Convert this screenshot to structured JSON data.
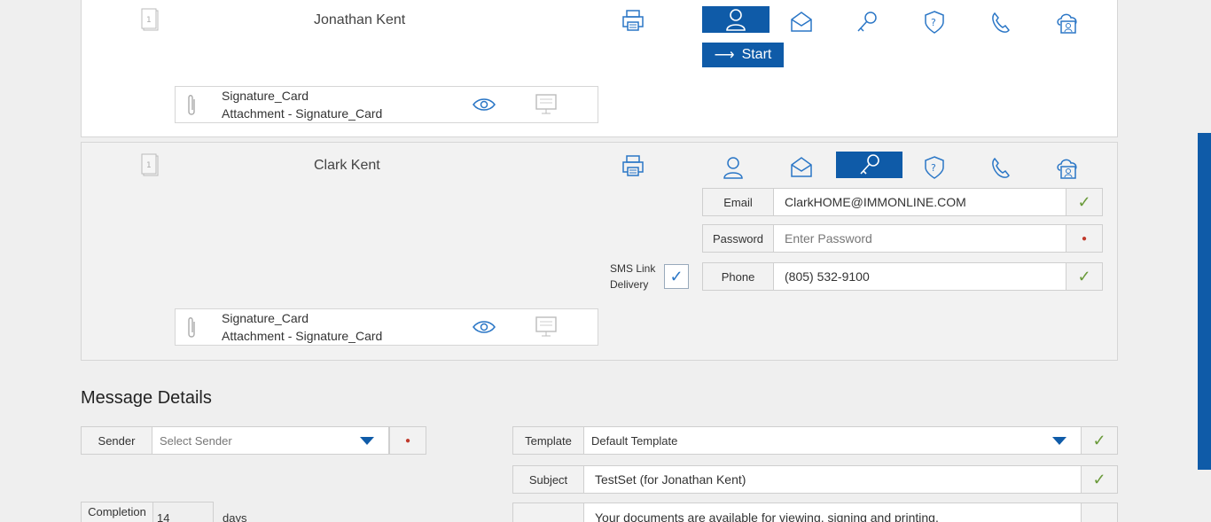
{
  "signers": [
    {
      "name": "Jonathan Kent",
      "start_label": "Start",
      "attachment": {
        "title": "Signature_Card",
        "subtitle": "Attachment - Signature_Card"
      }
    },
    {
      "name": "Clark Kent",
      "attachment": {
        "title": "Signature_Card",
        "subtitle": "Attachment - Signature_Card"
      },
      "sms_label_line1": "SMS Link",
      "sms_label_line2": "Delivery",
      "sms_checked": true,
      "fields": {
        "email_label": "Email",
        "email_value": "ClarkHOME@IMMONLINE.COM",
        "password_label": "Password",
        "password_placeholder": "Enter Password",
        "phone_label": "Phone",
        "phone_value": "(805) 532-9100"
      }
    }
  ],
  "message": {
    "title": "Message Details",
    "sender_label": "Sender",
    "sender_placeholder": "Select Sender",
    "template_label": "Template",
    "template_value": "Default Template",
    "subject_label": "Subject",
    "subject_value": "TestSet (for Jonathan Kent)",
    "completion_label": "Completion",
    "completion_value": "14",
    "completion_unit": "days",
    "body_text": "Your documents are available for viewing, signing and printing."
  },
  "icons": {
    "page": "page-icon",
    "print": "printer-icon",
    "person": "person-icon",
    "email": "email-icon",
    "key": "key-cloud-icon",
    "question": "question-shield-icon",
    "phone": "phone-cloud-icon",
    "id": "id-cloud-icon"
  },
  "colors": {
    "accent": "#0f5ba8",
    "check": "#6a9a3a",
    "required": "#c0392b"
  }
}
